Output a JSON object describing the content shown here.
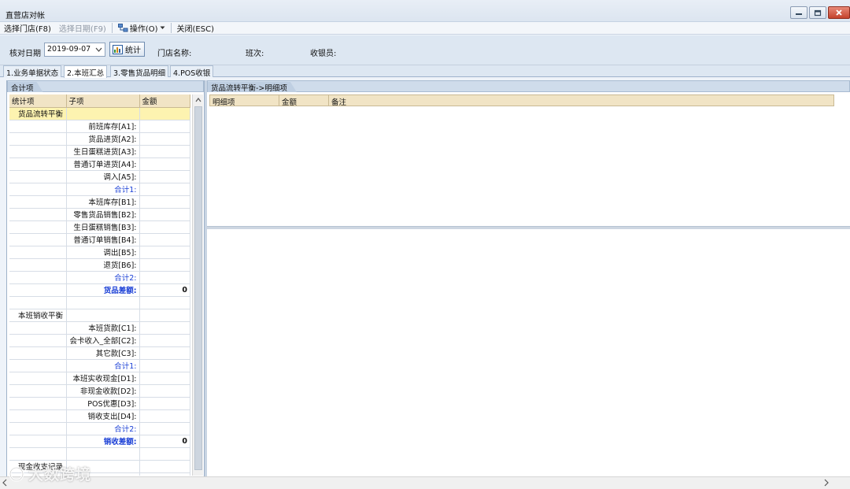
{
  "window": {
    "title": "直营店对帐"
  },
  "menu": {
    "select_store": "选择门店(F8)",
    "select_date": "选择日期(F9)",
    "operation": "操作(O)",
    "close": "关闭(ESC)"
  },
  "filter": {
    "date_label": "核对日期",
    "date_value": "2019-09-07",
    "stat_button": "统计",
    "store_name_label": "门店名称:",
    "shift_label": "班次:",
    "cashier_label": "收银员:"
  },
  "tabs": [
    "1.业务单据状态",
    "2.本班汇总",
    "3.零售货品明细",
    "4.POS收银"
  ],
  "left": {
    "header": "合计项",
    "columns": [
      "统计项",
      "子项",
      "金额"
    ],
    "rows": [
      {
        "c1": "货品流转平衡",
        "c2": "",
        "c3": ""
      },
      {
        "c1": "",
        "c2": "前班库存[A1]:",
        "c3": ""
      },
      {
        "c1": "",
        "c2": "货品进货[A2]:",
        "c3": ""
      },
      {
        "c1": "",
        "c2": "生日蛋糕进货[A3]:",
        "c3": ""
      },
      {
        "c1": "",
        "c2": "普通订单进货[A4]:",
        "c3": ""
      },
      {
        "c1": "",
        "c2": "调入[A5]:",
        "c3": ""
      },
      {
        "c1": "",
        "c2": "合计1:",
        "c3": ""
      },
      {
        "c1": "",
        "c2": "本班库存[B1]:",
        "c3": ""
      },
      {
        "c1": "",
        "c2": "零售货品销售[B2]:",
        "c3": ""
      },
      {
        "c1": "",
        "c2": "生日蛋糕销售[B3]:",
        "c3": ""
      },
      {
        "c1": "",
        "c2": "普通订单销售[B4]:",
        "c3": ""
      },
      {
        "c1": "",
        "c2": "调出[B5]:",
        "c3": ""
      },
      {
        "c1": "",
        "c2": "退货[B6]:",
        "c3": ""
      },
      {
        "c1": "",
        "c2": "合计2:",
        "c3": ""
      },
      {
        "c1": "",
        "c2": "货品差额:",
        "c3": "0"
      },
      {
        "c1": "",
        "c2": "",
        "c3": ""
      },
      {
        "c1": "本班销收平衡",
        "c2": "",
        "c3": ""
      },
      {
        "c1": "",
        "c2": "本班货款[C1]:",
        "c3": ""
      },
      {
        "c1": "",
        "c2": "会卡收入_全部[C2]:",
        "c3": ""
      },
      {
        "c1": "",
        "c2": "其它款[C3]:",
        "c3": ""
      },
      {
        "c1": "",
        "c2": "合计1:",
        "c3": ""
      },
      {
        "c1": "",
        "c2": "本班实收现金[D1]:",
        "c3": ""
      },
      {
        "c1": "",
        "c2": "非现金收款[D2]:",
        "c3": ""
      },
      {
        "c1": "",
        "c2": "POS优惠[D3]:",
        "c3": ""
      },
      {
        "c1": "",
        "c2": "销收支出[D4]:",
        "c3": ""
      },
      {
        "c1": "",
        "c2": "合计2:",
        "c3": ""
      },
      {
        "c1": "",
        "c2": "销收差额:",
        "c3": "0"
      },
      {
        "c1": "",
        "c2": "",
        "c3": ""
      },
      {
        "c1": "现金收支记录",
        "c2": "",
        "c3": ""
      },
      {
        "c1": "",
        "c2": "",
        "c3": ""
      }
    ]
  },
  "right": {
    "header": "货品流转平衡->明细项",
    "columns": [
      "明细项",
      "金额",
      "备注"
    ]
  },
  "watermark": "大数跨境"
}
